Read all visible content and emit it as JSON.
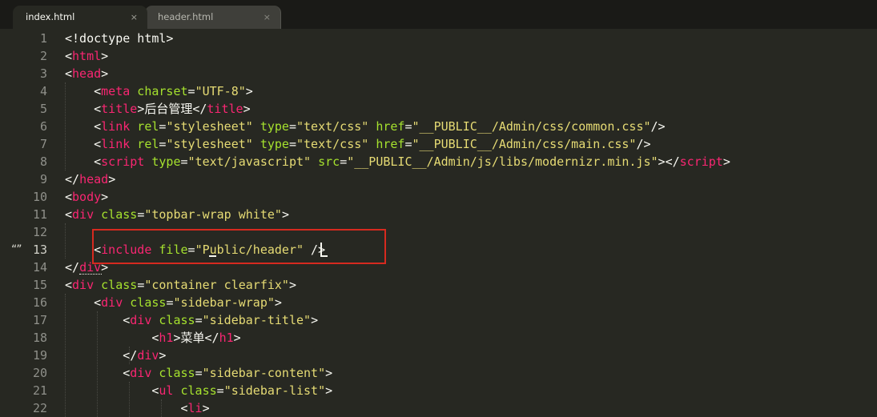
{
  "tabs": [
    {
      "label": "index.html",
      "close": "×"
    },
    {
      "label": "header.html",
      "close": "×"
    }
  ],
  "gutter": {
    "marker": "“”",
    "active_line": 13
  },
  "colors": {
    "background": "#272822",
    "tag": "#f92672",
    "attribute": "#a6e22e",
    "string": "#e6db74",
    "text": "#f8f8f2",
    "highlight_box": "#d62a1f"
  },
  "lines": [
    {
      "n": "1",
      "parts": [
        {
          "t": "<!doctype html>",
          "c": "punct"
        }
      ]
    },
    {
      "n": "2",
      "parts": [
        {
          "t": "<",
          "c": "punct"
        },
        {
          "t": "html",
          "c": "tag"
        },
        {
          "t": ">",
          "c": "punct"
        }
      ]
    },
    {
      "n": "3",
      "parts": [
        {
          "t": "<",
          "c": "punct"
        },
        {
          "t": "head",
          "c": "tag"
        },
        {
          "t": ">",
          "c": "punct"
        }
      ]
    },
    {
      "n": "4",
      "parts": [
        {
          "t": "    <",
          "c": "punct"
        },
        {
          "t": "meta",
          "c": "tag"
        },
        {
          "t": " charset",
          "c": "attr"
        },
        {
          "t": "=",
          "c": "punct"
        },
        {
          "t": "\"UTF-8\"",
          "c": "str"
        },
        {
          "t": ">",
          "c": "punct"
        }
      ]
    },
    {
      "n": "5",
      "parts": [
        {
          "t": "    <",
          "c": "punct"
        },
        {
          "t": "title",
          "c": "tag"
        },
        {
          "t": ">后台管理</",
          "c": "punct"
        },
        {
          "t": "title",
          "c": "tag"
        },
        {
          "t": ">",
          "c": "punct"
        }
      ]
    },
    {
      "n": "6",
      "parts": [
        {
          "t": "    <",
          "c": "punct"
        },
        {
          "t": "link",
          "c": "tag"
        },
        {
          "t": " rel",
          "c": "attr"
        },
        {
          "t": "=",
          "c": "punct"
        },
        {
          "t": "\"stylesheet\"",
          "c": "str"
        },
        {
          "t": " type",
          "c": "attr"
        },
        {
          "t": "=",
          "c": "punct"
        },
        {
          "t": "\"text/css\"",
          "c": "str"
        },
        {
          "t": " href",
          "c": "attr"
        },
        {
          "t": "=",
          "c": "punct"
        },
        {
          "t": "\"__PUBLIC__/Admin/css/common.css\"",
          "c": "str"
        },
        {
          "t": "/>",
          "c": "punct"
        }
      ]
    },
    {
      "n": "7",
      "parts": [
        {
          "t": "    <",
          "c": "punct"
        },
        {
          "t": "link",
          "c": "tag"
        },
        {
          "t": " rel",
          "c": "attr"
        },
        {
          "t": "=",
          "c": "punct"
        },
        {
          "t": "\"stylesheet\"",
          "c": "str"
        },
        {
          "t": " type",
          "c": "attr"
        },
        {
          "t": "=",
          "c": "punct"
        },
        {
          "t": "\"text/css\"",
          "c": "str"
        },
        {
          "t": " href",
          "c": "attr"
        },
        {
          "t": "=",
          "c": "punct"
        },
        {
          "t": "\"__PUBLIC__/Admin/css/main.css\"",
          "c": "str"
        },
        {
          "t": "/>",
          "c": "punct"
        }
      ]
    },
    {
      "n": "8",
      "parts": [
        {
          "t": "    <",
          "c": "punct"
        },
        {
          "t": "script",
          "c": "tag"
        },
        {
          "t": " type",
          "c": "attr"
        },
        {
          "t": "=",
          "c": "punct"
        },
        {
          "t": "\"text/javascript\"",
          "c": "str"
        },
        {
          "t": " src",
          "c": "attr"
        },
        {
          "t": "=",
          "c": "punct"
        },
        {
          "t": "\"__PUBLIC__/Admin/js/libs/modernizr.min.js\"",
          "c": "str"
        },
        {
          "t": "></",
          "c": "punct"
        },
        {
          "t": "script",
          "c": "tag"
        },
        {
          "t": ">",
          "c": "punct"
        }
      ]
    },
    {
      "n": "9",
      "parts": [
        {
          "t": "</",
          "c": "punct"
        },
        {
          "t": "head",
          "c": "tag"
        },
        {
          "t": ">",
          "c": "punct"
        }
      ]
    },
    {
      "n": "10",
      "parts": [
        {
          "t": "<",
          "c": "punct"
        },
        {
          "t": "body",
          "c": "tag"
        },
        {
          "t": ">",
          "c": "punct"
        }
      ]
    },
    {
      "n": "11",
      "parts": [
        {
          "t": "<",
          "c": "punct"
        },
        {
          "t": "div",
          "c": "tag"
        },
        {
          "t": " class",
          "c": "attr"
        },
        {
          "t": "=",
          "c": "punct"
        },
        {
          "t": "\"topbar-wrap white\"",
          "c": "str"
        },
        {
          "t": ">",
          "c": "punct"
        }
      ]
    },
    {
      "n": "12",
      "parts": []
    },
    {
      "n": "13",
      "parts": [
        {
          "t": "    <",
          "c": "punct"
        },
        {
          "t": "include",
          "c": "tag"
        },
        {
          "t": " file",
          "c": "attr"
        },
        {
          "t": "=",
          "c": "punct"
        },
        {
          "t": "\"Public/header\"",
          "c": "str"
        },
        {
          "t": " />",
          "c": "punct"
        }
      ]
    },
    {
      "n": "14",
      "parts": [
        {
          "t": "</",
          "c": "punct"
        },
        {
          "t": "div",
          "c": "tag"
        },
        {
          "t": ">",
          "c": "punct"
        }
      ]
    },
    {
      "n": "15",
      "parts": [
        {
          "t": "<",
          "c": "punct"
        },
        {
          "t": "div",
          "c": "tag"
        },
        {
          "t": " class",
          "c": "attr"
        },
        {
          "t": "=",
          "c": "punct"
        },
        {
          "t": "\"container clearfix\"",
          "c": "str"
        },
        {
          "t": ">",
          "c": "punct"
        }
      ]
    },
    {
      "n": "16",
      "parts": [
        {
          "t": "    <",
          "c": "punct"
        },
        {
          "t": "div",
          "c": "tag"
        },
        {
          "t": " class",
          "c": "attr"
        },
        {
          "t": "=",
          "c": "punct"
        },
        {
          "t": "\"sidebar-wrap\"",
          "c": "str"
        },
        {
          "t": ">",
          "c": "punct"
        }
      ]
    },
    {
      "n": "17",
      "parts": [
        {
          "t": "        <",
          "c": "punct"
        },
        {
          "t": "div",
          "c": "tag"
        },
        {
          "t": " class",
          "c": "attr"
        },
        {
          "t": "=",
          "c": "punct"
        },
        {
          "t": "\"sidebar-title\"",
          "c": "str"
        },
        {
          "t": ">",
          "c": "punct"
        }
      ]
    },
    {
      "n": "18",
      "parts": [
        {
          "t": "            <",
          "c": "punct"
        },
        {
          "t": "h1",
          "c": "tag"
        },
        {
          "t": ">菜单</",
          "c": "punct"
        },
        {
          "t": "h1",
          "c": "tag"
        },
        {
          "t": ">",
          "c": "punct"
        }
      ]
    },
    {
      "n": "19",
      "parts": [
        {
          "t": "        </",
          "c": "punct"
        },
        {
          "t": "div",
          "c": "tag"
        },
        {
          "t": ">",
          "c": "punct"
        }
      ]
    },
    {
      "n": "20",
      "parts": [
        {
          "t": "        <",
          "c": "punct"
        },
        {
          "t": "div",
          "c": "tag"
        },
        {
          "t": " class",
          "c": "attr"
        },
        {
          "t": "=",
          "c": "punct"
        },
        {
          "t": "\"sidebar-content\"",
          "c": "str"
        },
        {
          "t": ">",
          "c": "punct"
        }
      ]
    },
    {
      "n": "21",
      "parts": [
        {
          "t": "            <",
          "c": "punct"
        },
        {
          "t": "ul",
          "c": "tag"
        },
        {
          "t": " class",
          "c": "attr"
        },
        {
          "t": "=",
          "c": "punct"
        },
        {
          "t": "\"sidebar-list\"",
          "c": "str"
        },
        {
          "t": ">",
          "c": "punct"
        }
      ]
    },
    {
      "n": "22",
      "parts": [
        {
          "t": "                <",
          "c": "punct"
        },
        {
          "t": "li",
          "c": "tag"
        },
        {
          "t": ">",
          "c": "punct"
        }
      ]
    }
  ]
}
